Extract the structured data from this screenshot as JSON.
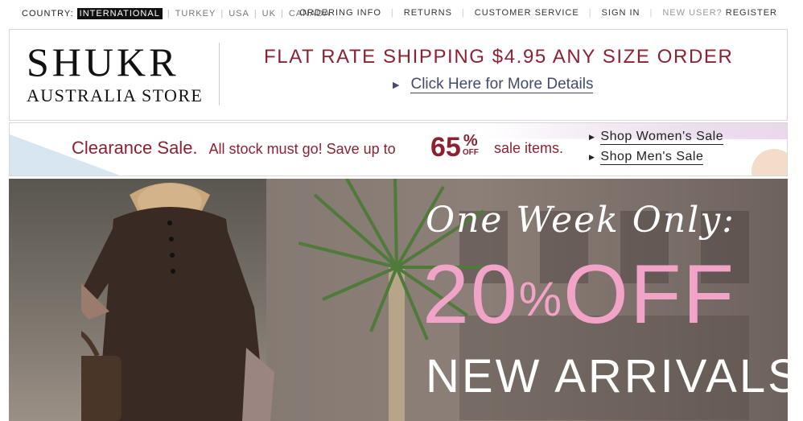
{
  "topbar": {
    "country_label": "COUNTRY:",
    "countries": [
      "INTERNATIONAL",
      "TURKEY",
      "USA",
      "UK",
      "CANADA"
    ],
    "selected_country": "INTERNATIONAL",
    "links": [
      "ORDERING INFO",
      "RETURNS",
      "CUSTOMER SERVICE",
      "SIGN IN"
    ],
    "new_user": "NEW USER?",
    "register": "REGISTER"
  },
  "header": {
    "logo_line1": "SHUKR",
    "logo_line2": "AUSTRALIA STORE",
    "shipping_text": "FLAT RATE SHIPPING $4.95 ANY SIZE ORDER",
    "details_link": "Click Here for More Details"
  },
  "promo": {
    "title": "Clearance Sale.",
    "subtitle": "All stock must go!  Save up to",
    "percent": "65",
    "percent_symbol": "%",
    "off_label": "OFF",
    "suffix": "sale items.",
    "links": [
      "Shop Women's Sale",
      "Shop Men's Sale"
    ]
  },
  "hero": {
    "tagline": "One Week Only:",
    "discount": "20",
    "discount_symbol": "%",
    "discount_word": "OFF",
    "headline": "NEW ARRIVALS"
  },
  "colors": {
    "brand_red": "#8b2232",
    "link_blue": "#444a6e",
    "hero_pink": "#f2a3c8"
  }
}
